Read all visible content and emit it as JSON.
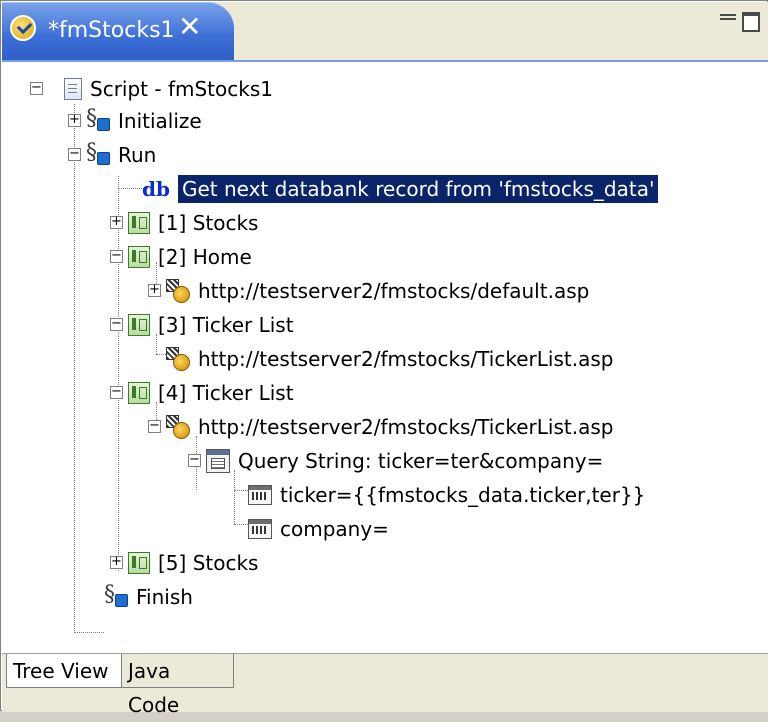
{
  "editor": {
    "tab_title": "*fmStocks1",
    "close_symbol": "✕"
  },
  "tree": {
    "root_label": "Script - fmStocks1",
    "items": [
      {
        "id": "initialize",
        "label": "Initialize",
        "icon": "procedure-icon",
        "expander": "+"
      },
      {
        "id": "run",
        "label": "Run",
        "icon": "procedure-icon",
        "expander": "−"
      },
      {
        "id": "databank",
        "label": "Get next databank record from 'fmstocks_data'",
        "icon": "databank-icon",
        "icon_text": "db",
        "selected": true
      },
      {
        "id": "stocks1",
        "label": "[1] Stocks",
        "icon": "page-step-icon",
        "expander": "+"
      },
      {
        "id": "home2",
        "label": "[2] Home",
        "icon": "page-step-icon",
        "expander": "−"
      },
      {
        "id": "home2-url",
        "label": "http://testserver2/fmstocks/default.asp",
        "icon": "url-icon",
        "expander": "+"
      },
      {
        "id": "ticker3",
        "label": "[3] Ticker List",
        "icon": "page-step-icon",
        "expander": "−"
      },
      {
        "id": "ticker3-url",
        "label": "http://testserver2/fmstocks/TickerList.asp",
        "icon": "url-icon"
      },
      {
        "id": "ticker4",
        "label": "[4] Ticker List",
        "icon": "page-step-icon",
        "expander": "−"
      },
      {
        "id": "ticker4-url",
        "label": "http://testserver2/fmstocks/TickerList.asp",
        "icon": "url-icon",
        "expander": "−"
      },
      {
        "id": "query",
        "label": "Query String: ticker=ter&company=",
        "icon": "query-icon",
        "expander": "−"
      },
      {
        "id": "param-ticker",
        "label": "ticker={{fmstocks_data.ticker,ter}}",
        "icon": "parameter-icon"
      },
      {
        "id": "param-company",
        "label": "company=",
        "icon": "parameter-icon"
      },
      {
        "id": "stocks5",
        "label": "[5] Stocks",
        "icon": "page-step-icon",
        "expander": "+"
      },
      {
        "id": "finish",
        "label": "Finish",
        "icon": "procedure-icon"
      }
    ]
  },
  "bottom_tabs": {
    "tree_view": "Tree View",
    "java_code": "Java Code"
  }
}
